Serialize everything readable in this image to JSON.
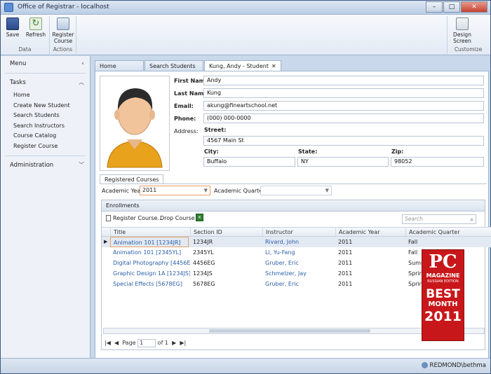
{
  "window": {
    "title": "Office of Registrar - localhost",
    "min": "–",
    "max": "□",
    "close": "✕"
  },
  "ribbon": {
    "data_group": {
      "label": "Data",
      "save": "Save",
      "refresh": "Refresh"
    },
    "actions_group": {
      "label": "Actions",
      "register_line1": "Register",
      "register_line2": "Course"
    },
    "customize_group": {
      "label": "Customize",
      "design_line1": "Design",
      "design_line2": "Screen"
    }
  },
  "sidebar": {
    "menu_label": "Menu",
    "tasks_label": "Tasks",
    "items": [
      "Home",
      "Create New Student",
      "Search Students",
      "Search Instructors",
      "Course Catalog",
      "Register Course"
    ],
    "administration_label": "Administration"
  },
  "tabs": [
    {
      "label": "Home"
    },
    {
      "label": "Search Students"
    },
    {
      "label": "Kung, Andy - Student",
      "close": "✕"
    }
  ],
  "student": {
    "first_name_label": "First Name:",
    "first_name": "Andy",
    "last_name_label": "Last Name:",
    "last_name": "Kung",
    "email_label": "Email:",
    "email": "akung@fineartschool.net",
    "phone_label": "Phone:",
    "phone": "(000) 000-0000",
    "address_label": "Address:",
    "street_label": "Street:",
    "street": "4567 Main St",
    "city_label": "City:",
    "city": "Buffalo",
    "state_label": "State:",
    "state": "NY",
    "zip_label": "Zip:",
    "zip": "98052"
  },
  "registered": {
    "tab_label": "Registered Courses",
    "year_label": "Academic Year:",
    "year_value": "2011",
    "quarter_label": "Academic Quarter:",
    "quarter_value": ""
  },
  "enrollments": {
    "title": "Enrollments",
    "register_btn": "Register Course...",
    "drop_btn": "Drop Course",
    "search_placeholder": "Search",
    "columns": [
      "Title",
      "Section ID",
      "Instructor",
      "Academic Year",
      "Academic Quarter"
    ],
    "rows": [
      {
        "title": "Animation 101 [1234JR]",
        "section": "1234JR",
        "instructor": "Rivard, John",
        "year": "2011",
        "quarter": "Fall"
      },
      {
        "title": "Animation 101 [2345YL]",
        "section": "2345YL",
        "instructor": "Li, Yu-Fang",
        "year": "2011",
        "quarter": "Fall"
      },
      {
        "title": "Digital Photography [4456EG]",
        "section": "4456EG",
        "instructor": "Gruber, Eric",
        "year": "2011",
        "quarter": "Summ"
      },
      {
        "title": "Graphic Design 1A [1234JS]",
        "section": "1234JS",
        "instructor": "Schmelzer, Jay",
        "year": "2011",
        "quarter": "Spring"
      },
      {
        "title": "Special Effects [5678EG]",
        "section": "5678EG",
        "instructor": "Gruber, Eric",
        "year": "2011",
        "quarter": "Spring"
      }
    ],
    "pager": {
      "page_label": "Page",
      "page_value": "1",
      "of_label": "of 1"
    }
  },
  "status": {
    "user": "REDMOND\\bethma"
  },
  "badge": {
    "line1": "PC",
    "line2": "MAGAZINE",
    "line3": "RUSSIAN EDITION",
    "line4": "BEST",
    "line5": "MONTH",
    "line6": "2011"
  },
  "colors": {
    "accent": "#2a5fa8",
    "badge_red": "#c8171a",
    "selected_combo_border": "#e8a064"
  }
}
